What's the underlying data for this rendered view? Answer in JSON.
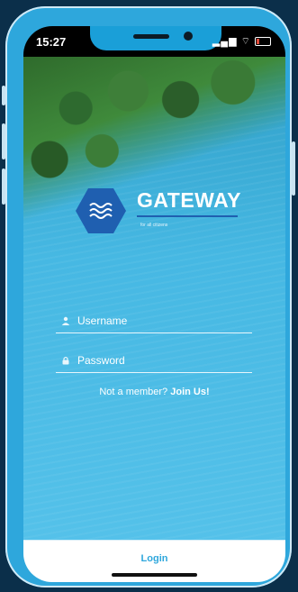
{
  "status": {
    "time": "15:27"
  },
  "brand": {
    "name": "GATEWAY",
    "tagline": "for all citizens"
  },
  "form": {
    "username_placeholder": "Username",
    "password_placeholder": "Password",
    "member_prompt": "Not a member?",
    "join_label": "Join Us!"
  },
  "footer": {
    "login_label": "Login"
  },
  "colors": {
    "accent": "#2ea7dc",
    "logo": "#1f5fb0"
  }
}
